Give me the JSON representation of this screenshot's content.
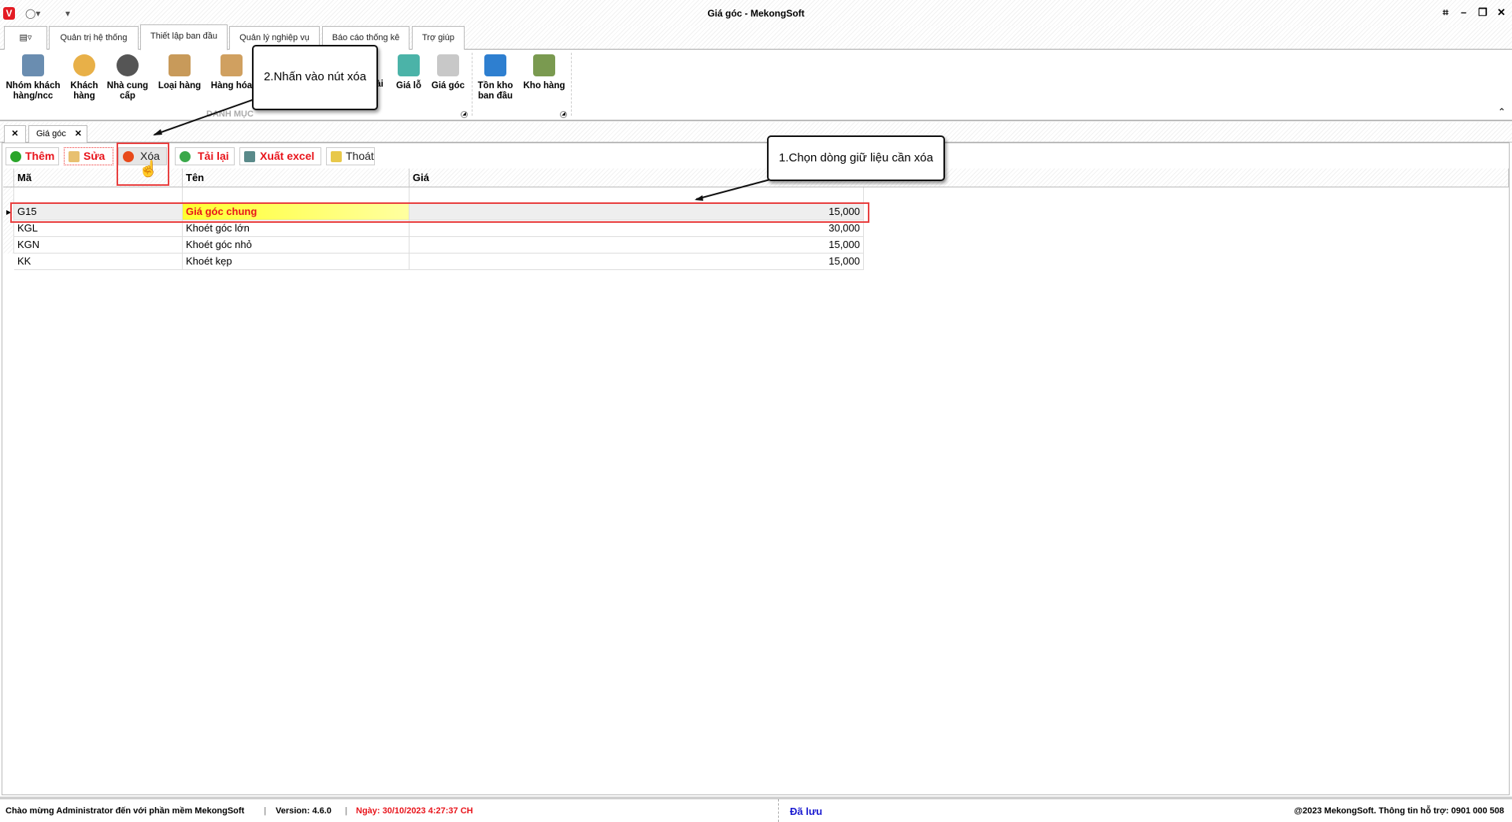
{
  "window": {
    "title": "Giá góc - MekongSoft",
    "logo": "V"
  },
  "menu_tabs": [
    {
      "label": "Quản trị hệ thống"
    },
    {
      "label": "Thiết lập ban đầu"
    },
    {
      "label": "Quản lý nghiệp vụ"
    },
    {
      "label": "Báo cáo thống kê"
    },
    {
      "label": "Trợ giúp"
    }
  ],
  "ribbon": {
    "group_label": "DANH MỤC",
    "items": [
      {
        "label": "Nhóm khách hàng/ncc",
        "icon": "customer-group-icon",
        "color": "#6a8db0"
      },
      {
        "label": "Khách hàng",
        "icon": "customer-icon",
        "color": "#e8b048"
      },
      {
        "label": "Nhà cung cấp",
        "icon": "supplier-icon",
        "color": "#555"
      },
      {
        "label": "Loại hàng",
        "icon": "category-icon",
        "color": "#c89a5a"
      },
      {
        "label": "Hàng hóa",
        "icon": "goods-icon",
        "color": "#d0a060"
      },
      {
        "label": "ài",
        "icon": "hidden-icon",
        "color": "#fff"
      },
      {
        "label": "Giá lỗ",
        "icon": "price-hole-icon",
        "color": "#4bb3a8"
      },
      {
        "label": "Giá góc",
        "icon": "price-corner-icon",
        "color": "#c8c8c8"
      },
      {
        "label": "Tồn kho ban đầu",
        "icon": "opening-stock-icon",
        "color": "#2e7fd0"
      },
      {
        "label": "Kho hàng",
        "icon": "warehouse-icon",
        "color": "#7a9a50"
      }
    ]
  },
  "doc_tabs": {
    "active": "Giá góc"
  },
  "toolbar": {
    "add": "Thêm",
    "edit": "Sửa",
    "delete": "Xóa",
    "reload": "Tải lại",
    "export": "Xuất excel",
    "exit": "Thoát"
  },
  "grid": {
    "columns": [
      "Mã",
      "Tên",
      "Giá"
    ],
    "rows": [
      {
        "code": "G15",
        "name": "Giá góc chung",
        "price": "15,000"
      },
      {
        "code": "KGL",
        "name": "Khoét góc lớn",
        "price": "30,000"
      },
      {
        "code": "KGN",
        "name": "Khoét góc nhỏ",
        "price": "15,000"
      },
      {
        "code": "KK",
        "name": "Khoét kẹp",
        "price": "15,000"
      }
    ]
  },
  "callouts": {
    "step1": "1.Chọn dòng giữ liệu cần xóa",
    "step2": "2.Nhấn vào nút xóa"
  },
  "status": {
    "welcome": "Chào mừng Administrator đến với phần mềm MekongSoft",
    "version": "Version: 4.6.0",
    "date": "Ngày: 30/10/2023 4:27:37 CH",
    "saved": "Đã lưu",
    "copyright": "@2023 MekongSoft. Thông tin hỗ trợ: 0901 000 508"
  }
}
